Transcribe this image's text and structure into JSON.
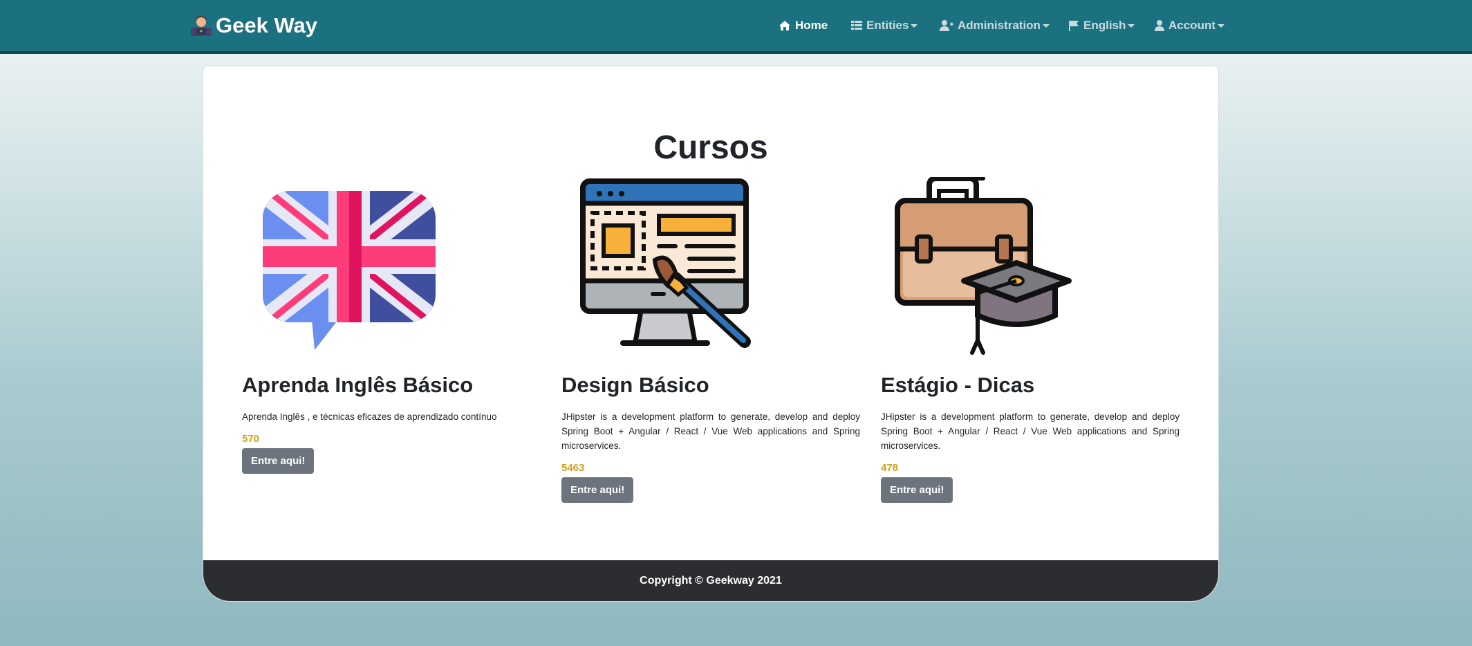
{
  "app": {
    "brand": "Geek Way"
  },
  "nav": {
    "home": "Home",
    "entities": "Entities",
    "administration": "Administration",
    "language": "English",
    "account": "Account"
  },
  "main": {
    "title": "Cursos",
    "courses": [
      {
        "title": "Aprenda Inglês Básico",
        "description": "Aprenda Inglês , e técnicas eficazes de aprendizado contínuo",
        "count": "570",
        "button": "Entre aqui!",
        "icon": "uk-flag-speech-bubble-icon"
      },
      {
        "title": "Design Básico",
        "description": "JHipster is a development platform to generate, develop and deploy Spring Boot + Angular / React / Vue Web applications and Spring microservices.",
        "count": "5463",
        "button": "Entre aqui!",
        "icon": "web-design-monitor-icon"
      },
      {
        "title": "Estágio - Dicas",
        "description": "JHipster is a development platform to generate, develop and deploy Spring Boot + Angular / React / Vue Web applications and Spring microservices.",
        "count": "478",
        "button": "Entre aqui!",
        "icon": "briefcase-graduation-cap-icon"
      }
    ]
  },
  "footer": {
    "copyright": "Copyright © Geekway 2021"
  },
  "colors": {
    "navbar": "#1c7180",
    "count": "#d4a017",
    "button": "#6c757d",
    "footer": "#2b2d30"
  }
}
